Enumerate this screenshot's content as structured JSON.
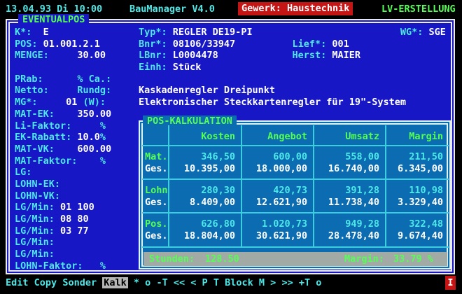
{
  "colors": {
    "panel_blue": "#1717c6",
    "kalk_blue": "#0c6cb2",
    "cyan": "#4ee8e8",
    "green": "#55ff55",
    "red": "#c41414",
    "gray_bar": "#a2aaa6",
    "white": "#ffffff"
  },
  "topbar": {
    "datetime": "13.04.93 Di 10:00",
    "app_title": "BauManager V4.0",
    "gewerk": "Gewerk: Haustechnik",
    "mode": "LV-ERSTELLUNG"
  },
  "panel": {
    "title": "EVENTUALPOS",
    "left_lines": [
      [
        {
          "t": "K*:  ",
          "c": "l"
        },
        {
          "t": "E",
          "c": "v"
        }
      ],
      [
        {
          "t": "POS: ",
          "c": "l"
        },
        {
          "t": "01.001.2.1",
          "c": "v"
        }
      ],
      [
        {
          "t": "MENGE:     ",
          "c": "l"
        },
        {
          "t": "30.00",
          "c": "v"
        }
      ],
      [],
      [
        {
          "t": "PRab:      % Ca.:",
          "c": "l"
        }
      ],
      [
        {
          "t": "Netto:     Rundg:",
          "c": "l"
        }
      ],
      [
        {
          "t": "MG*:     ",
          "c": "l"
        },
        {
          "t": "01",
          "c": "v"
        },
        {
          "t": " (W):",
          "c": "l"
        }
      ],
      [
        {
          "t": "MAT-EK:    ",
          "c": "l"
        },
        {
          "t": "350.00",
          "c": "v"
        }
      ],
      [
        {
          "t": "Li-Faktor:     %",
          "c": "l"
        }
      ],
      [
        {
          "t": "EK-Rabatt: ",
          "c": "l"
        },
        {
          "t": "10.0",
          "c": "v"
        },
        {
          "t": "%",
          "c": "l"
        }
      ],
      [
        {
          "t": "MAT-VK:    ",
          "c": "l"
        },
        {
          "t": "600.00",
          "c": "v"
        }
      ],
      [
        {
          "t": "MAT-Faktor:    %",
          "c": "l"
        }
      ],
      [
        {
          "t": "LG:",
          "c": "l"
        }
      ],
      [
        {
          "t": "LOHN-EK:",
          "c": "l"
        }
      ],
      [
        {
          "t": "LOHN-VK:",
          "c": "l"
        }
      ],
      [
        {
          "t": "LG/Min: ",
          "c": "l"
        },
        {
          "t": "01 100",
          "c": "v"
        }
      ],
      [
        {
          "t": "LG/Min: ",
          "c": "l"
        },
        {
          "t": "08 80",
          "c": "v"
        }
      ],
      [
        {
          "t": "LG/Min: ",
          "c": "l"
        },
        {
          "t": "03 77",
          "c": "v"
        }
      ],
      [
        {
          "t": "LG/Min:",
          "c": "l"
        }
      ],
      [
        {
          "t": "LG/Min:",
          "c": "l"
        }
      ],
      [
        {
          "t": "LOHN-Faktor:   %",
          "c": "l"
        }
      ]
    ],
    "right_lines": [
      [
        {
          "t": "Typ*: ",
          "c": "l"
        },
        {
          "t": "REGLER DE19-PI",
          "c": "v"
        },
        {
          "t": "                          ",
          "c": "l"
        },
        {
          "t": "WG*: ",
          "c": "l"
        },
        {
          "t": "SGE",
          "c": "v"
        }
      ],
      [
        {
          "t": "Bnr*: ",
          "c": "l"
        },
        {
          "t": "08106/33947",
          "c": "v"
        },
        {
          "t": "          ",
          "c": "l"
        },
        {
          "t": "Lief*: ",
          "c": "l"
        },
        {
          "t": "001",
          "c": "v"
        }
      ],
      [
        {
          "t": "LBnr: ",
          "c": "l"
        },
        {
          "t": "L0004478",
          "c": "v"
        },
        {
          "t": "             ",
          "c": "l"
        },
        {
          "t": "Herst: ",
          "c": "l"
        },
        {
          "t": "MAIER",
          "c": "v"
        }
      ],
      [
        {
          "t": "Einh: ",
          "c": "l"
        },
        {
          "t": "Stück",
          "c": "v"
        }
      ],
      [],
      [
        {
          "t": "Kaskadenregler Dreipunkt",
          "c": "v"
        }
      ],
      [
        {
          "t": "Elektronischer Steckkartenregler für 19\"-System",
          "c": "v"
        }
      ]
    ]
  },
  "kalk": {
    "title": "POS-KALKULATION",
    "columns": [
      "Kosten",
      "Angebot",
      "Umsatz",
      "Margin"
    ],
    "ges_label": "Ges.",
    "groups": [
      {
        "label": "Mat.",
        "unit": [
          "346,50",
          "600,00",
          "558,00",
          "211,50"
        ],
        "ges": [
          "10.395,00",
          "18.000,00",
          "16.740,00",
          "6.345,00"
        ]
      },
      {
        "label": "Lohn",
        "unit": [
          "280,30",
          "420,73",
          "391,28",
          "110,98"
        ],
        "ges": [
          "8.409,00",
          "12.621,90",
          "11.738,40",
          "3.329,40"
        ]
      },
      {
        "label": "Pos.",
        "unit": [
          "626,80",
          "1.020,73",
          "949,28",
          "322,48"
        ],
        "ges": [
          "18.804,00",
          "30.621,90",
          "28.478,40",
          "9.674,40"
        ]
      }
    ],
    "footer": {
      "stunden_label": "Stunden:",
      "stunden_value": "128.50",
      "margin_label": "Margin:",
      "margin_value": "33.79 %"
    }
  },
  "menubar": {
    "items": [
      "Edit",
      "Copy",
      "Sonder",
      "Kalk",
      "*",
      "o",
      "-T",
      "<<",
      "<",
      "P",
      "T",
      "Block",
      "M",
      ">",
      ">>",
      "+T",
      "o"
    ],
    "active_index": 3,
    "insert_indicator": "I"
  }
}
